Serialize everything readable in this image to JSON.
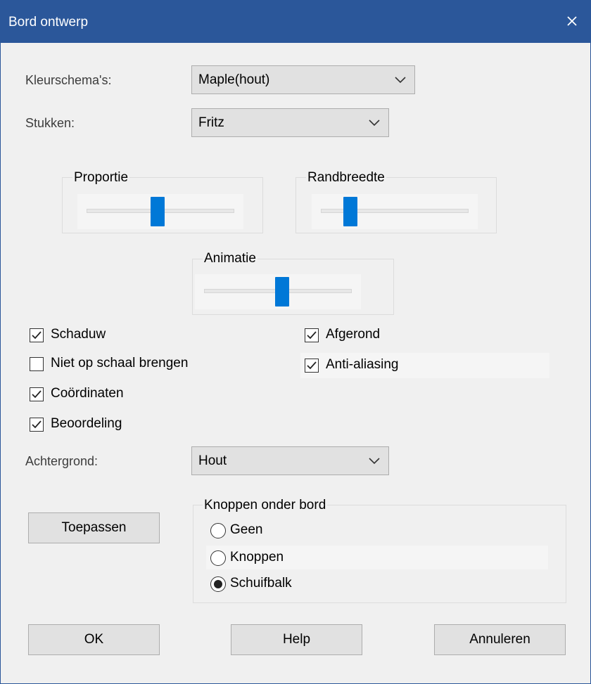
{
  "window": {
    "title": "Bord ontwerp"
  },
  "color_scheme": {
    "label": "Kleurschema's:",
    "value": "Maple(hout)"
  },
  "pieces": {
    "label": "Stukken:",
    "value": "Fritz"
  },
  "sliders": {
    "proportion": {
      "label": "Proportie",
      "level": 0.48
    },
    "border_width": {
      "label": "Randbreedte",
      "level": 0.17
    },
    "animation": {
      "label": "Animatie",
      "level": 0.53
    }
  },
  "checkboxes": {
    "shadow": {
      "label": "Schaduw",
      "checked": true
    },
    "no_scaling": {
      "label": "Niet op schaal brengen",
      "checked": false
    },
    "coordinates": {
      "label": "Coördinaten",
      "checked": true
    },
    "rating": {
      "label": "Beoordeling",
      "checked": true
    },
    "rounded": {
      "label": "Afgerond",
      "checked": true
    },
    "anti_aliasing": {
      "label": "Anti-aliasing",
      "checked": true
    }
  },
  "background": {
    "label": "Achtergrond:",
    "value": "Hout"
  },
  "buttons": {
    "apply": "Toepassen",
    "ok": "OK",
    "help": "Help",
    "cancel": "Annuleren"
  },
  "buttons_below_board": {
    "title": "Knoppen onder bord",
    "options": [
      {
        "label": "Geen",
        "selected": false
      },
      {
        "label": "Knoppen",
        "selected": false
      },
      {
        "label": "Schuifbalk",
        "selected": true
      }
    ]
  },
  "colors": {
    "titlebar": "#2b579a",
    "slider_thumb": "#0078d7",
    "dialog_bg": "#f0f0f0"
  },
  "icons": {
    "close": "close-icon",
    "dropdown": "chevron-down-icon",
    "check": "check-icon"
  }
}
